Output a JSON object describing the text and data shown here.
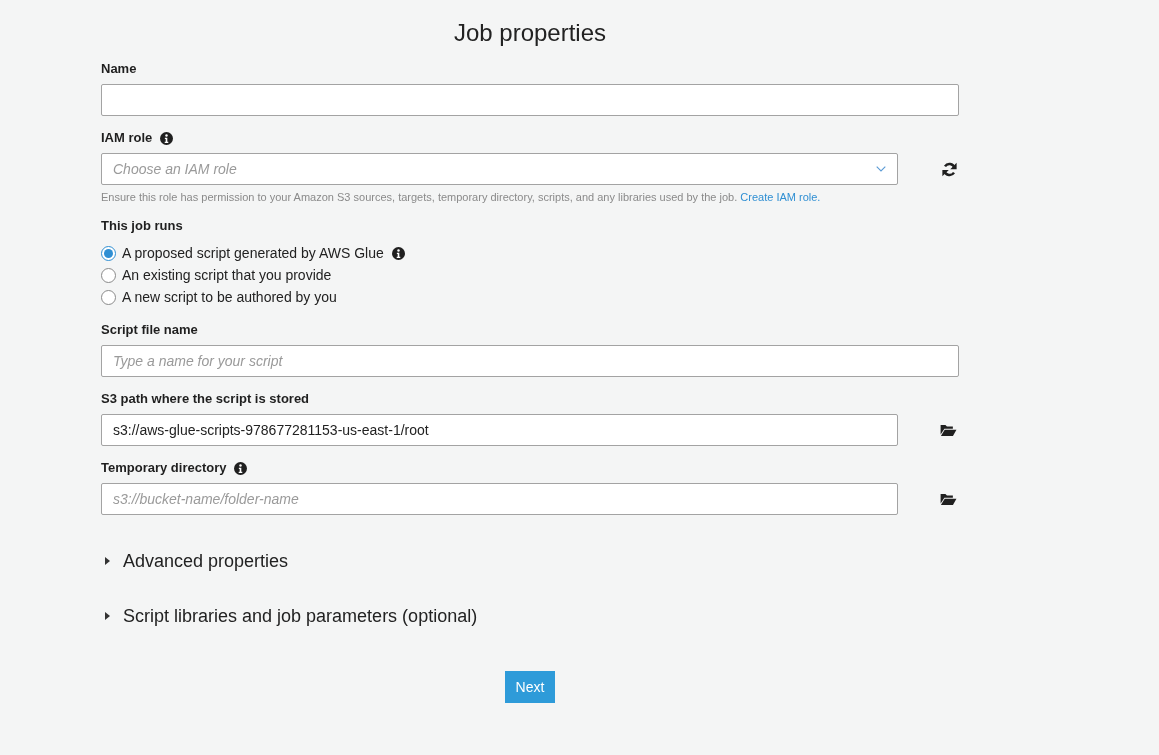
{
  "title": "Job properties",
  "fields": [
    {
      "kind": "text",
      "label": "Name",
      "info": false
    },
    {
      "kind": "select",
      "label": "IAM role",
      "info": true,
      "placeholder": "Choose an IAM role",
      "help": "Ensure this role has permission to your Amazon S3 sources, targets, temporary directory, scripts, and any libraries used by the job.",
      "help_link": "Create IAM role."
    },
    {
      "kind": "radio",
      "label": "This job runs",
      "info": false,
      "options": [
        {
          "label": "A proposed script generated by AWS Glue",
          "selected": true,
          "info": true
        },
        {
          "label": "An existing script that you provide",
          "selected": false,
          "info": false
        },
        {
          "label": "A new script to be authored by you",
          "selected": false,
          "info": false
        }
      ]
    },
    {
      "kind": "text",
      "label": "Script file name",
      "info": false,
      "placeholder": "Type a name for your script"
    },
    {
      "kind": "path",
      "label": "S3 path where the script is stored",
      "info": false,
      "value": "s3://aws-glue-scripts-978677281153-us-east-1/root"
    },
    {
      "kind": "path",
      "label": "Temporary directory",
      "info": true,
      "placeholder": "s3://bucket-name/folder-name"
    }
  ],
  "sections": [
    {
      "label": "Advanced properties",
      "expanded": false
    },
    {
      "label": "Script libraries and job parameters (optional)",
      "expanded": false
    }
  ],
  "button": "Next"
}
